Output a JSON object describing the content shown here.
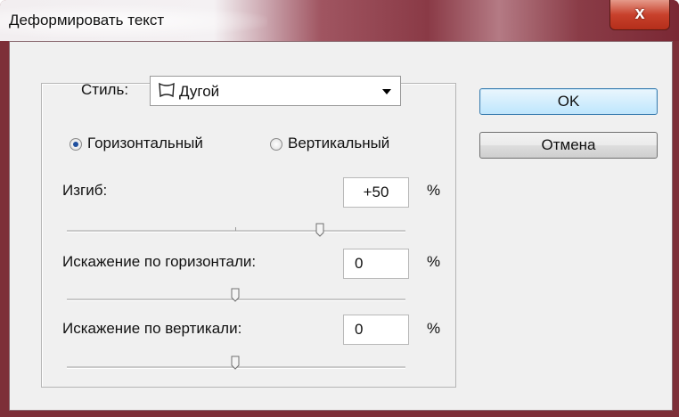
{
  "dialog": {
    "title": "Деформировать текст",
    "close_label": "x",
    "style_label": "Стиль:",
    "style_value": "Дугой",
    "orientation": {
      "horizontal_label": "Горизонтальный",
      "vertical_label": "Вертикальный",
      "selected": "horizontal"
    },
    "bend": {
      "label": "Изгиб:",
      "value": "+50",
      "unit": "%",
      "slider_value": 50
    },
    "h_distortion": {
      "label": "Искажение по горизонтали:",
      "value": "0",
      "unit": "%",
      "slider_value": 0
    },
    "v_distortion": {
      "label": "Искажение по вертикали:",
      "value": "0",
      "unit": "%",
      "slider_value": 0
    },
    "ok_label": "OK",
    "cancel_label": "Отмена"
  },
  "icons": {
    "close": "close-icon",
    "style_shape": "arc-shape-icon",
    "dropdown": "chevron-down-icon"
  },
  "colors": {
    "title_bar": "#8a3a46",
    "close_button": "#c8412c",
    "dialog_bg": "#f0f0f0",
    "ok_button": "#bee6fd",
    "radio_dot": "#1f4f9e"
  }
}
